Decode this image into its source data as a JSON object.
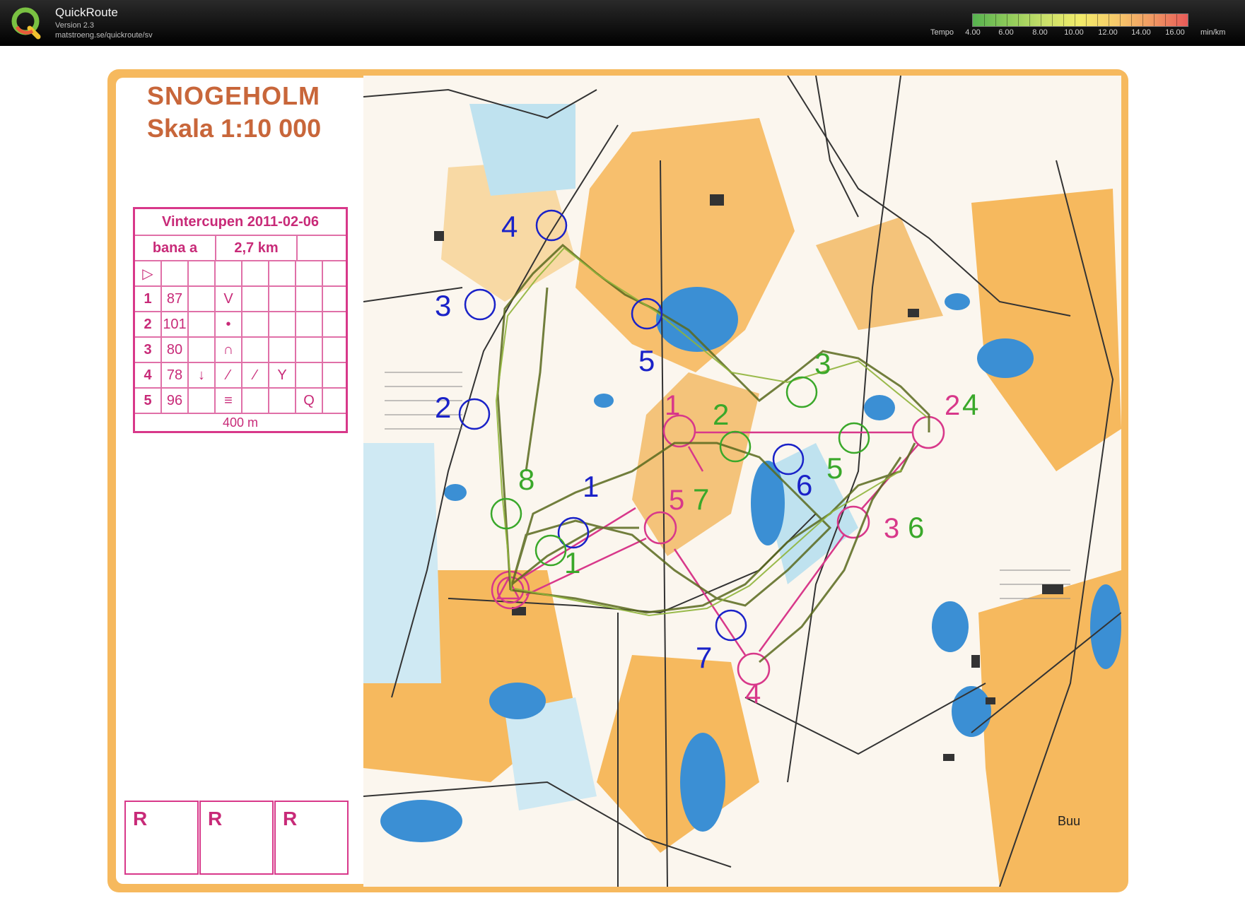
{
  "app": {
    "name": "QuickRoute",
    "version": "Version 2.3",
    "url": "matstroeng.se/quickroute/sv"
  },
  "tempo_legend": {
    "label": "Tempo",
    "ticks": [
      "4.00",
      "6.00",
      "8.00",
      "10.00",
      "12.00",
      "14.00",
      "16.00"
    ],
    "unit": "min/km"
  },
  "map": {
    "title": "SNOGEHOLM",
    "scale": "Skala 1:10 000",
    "place_label": "Buu",
    "control_description": {
      "event": "Vintercupen 2011-02-06",
      "course": "bana a",
      "length": "2,7 km",
      "start_symbol": "▷",
      "controls": [
        {
          "num": "1",
          "code": "87",
          "symbol": "V"
        },
        {
          "num": "2",
          "code": "101",
          "symbol": "•"
        },
        {
          "num": "3",
          "code": "80",
          "symbol": "∩"
        },
        {
          "num": "4",
          "code": "78",
          "symbol": "↓"
        },
        {
          "num": "5",
          "code": "96",
          "symbol": "≡"
        }
      ],
      "finish_distance": "400 m"
    },
    "r_boxes": [
      "R",
      "R",
      "R"
    ],
    "control_numbers_blue": [
      "1",
      "2",
      "3",
      "4",
      "5",
      "6",
      "7"
    ],
    "control_numbers_green": [
      "1",
      "2",
      "3",
      "4",
      "5",
      "6",
      "7",
      "8"
    ],
    "control_numbers_pink": [
      "1",
      "2",
      "3",
      "4",
      "5"
    ],
    "colors": {
      "open_land": "#f6b95e",
      "water": "#3b8fd4",
      "marsh": "#9cd1e8",
      "course_pink": "#d8388a",
      "route_blue": "#1a22c8",
      "route_green": "#3aa82a",
      "route_line": "#5a6a1e"
    }
  }
}
